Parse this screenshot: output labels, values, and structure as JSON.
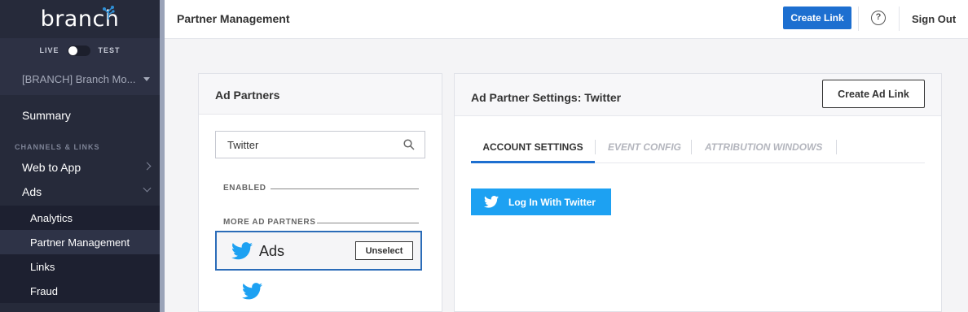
{
  "brand": {
    "logo_text": "branch"
  },
  "env": {
    "live_label": "LIVE",
    "test_label": "TEST"
  },
  "org": {
    "selected": "[BRANCH] Branch Mo..."
  },
  "sidebar": {
    "summary_label": "Summary",
    "section_label": "CHANNELS & LINKS",
    "items": [
      {
        "label": "Web to App"
      },
      {
        "label": "Ads"
      }
    ],
    "sub_items": [
      {
        "label": "Analytics"
      },
      {
        "label": "Partner Management"
      },
      {
        "label": "Links"
      },
      {
        "label": "Fraud"
      }
    ]
  },
  "header": {
    "title": "Partner Management",
    "create_link_label": "Create Link",
    "help_label": "?",
    "sign_out_label": "Sign Out"
  },
  "ad_partners": {
    "title": "Ad Partners",
    "search_value": "Twitter",
    "enabled_label": "ENABLED",
    "more_label": "MORE AD PARTNERS",
    "partner_name": "Ads",
    "unselect_label": "Unselect"
  },
  "settings": {
    "title": "Ad Partner Settings: Twitter",
    "create_ad_link_label": "Create Ad Link",
    "tabs": [
      {
        "label": "ACCOUNT SETTINGS"
      },
      {
        "label": "EVENT CONFIG"
      },
      {
        "label": "ATTRIBUTION WINDOWS"
      }
    ],
    "login_label": "Log In With Twitter"
  },
  "colors": {
    "sidebar_bg": "#262a3a",
    "accent_blue": "#1d6fd0",
    "twitter_blue": "#1da1f2"
  }
}
